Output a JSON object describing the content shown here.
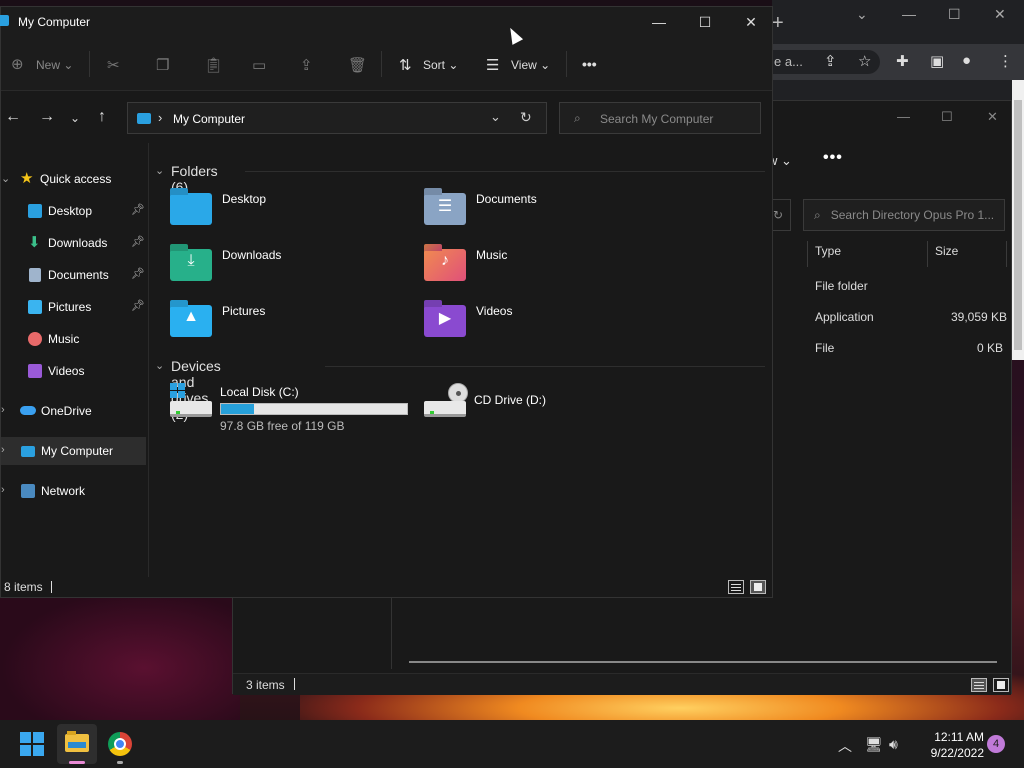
{
  "explorer": {
    "title": "My Computer",
    "commands": {
      "new": "New",
      "sort": "Sort",
      "view": "View",
      "more": "•••"
    },
    "address": "My Computer",
    "search_placeholder": "Search My Computer",
    "nav": {
      "quick_access": "Quick access",
      "pinned": [
        "Desktop",
        "Downloads",
        "Documents",
        "Pictures"
      ],
      "unpinned": [
        "Music",
        "Videos"
      ],
      "onedrive": "OneDrive",
      "my_computer": "My Computer",
      "network": "Network"
    },
    "folders_header": "Folders (6)",
    "folders": [
      "Desktop",
      "Documents",
      "Downloads",
      "Music",
      "Pictures",
      "Videos"
    ],
    "drives_header": "Devices and drives (2)",
    "drives": [
      {
        "name": "Local Disk (C:)",
        "free_text": "97.8 GB free of 119 GB",
        "used_fraction": 0.18
      },
      {
        "name": "CD Drive (D:)"
      }
    ],
    "status": "8 items"
  },
  "opus": {
    "toolbar_fragment": "w",
    "more": "•••",
    "search_placeholder": "Search Directory Opus Pro 1...",
    "columns": [
      "Type",
      "Size"
    ],
    "rows": [
      {
        "type": "File folder",
        "size": ""
      },
      {
        "type": "Application",
        "size": "39,059 KB"
      },
      {
        "type": "File",
        "size": "0 KB"
      }
    ],
    "status": "3 items"
  },
  "chrome": {
    "omnibox_fragment": "e a..."
  },
  "taskbar": {
    "time": "12:11 AM",
    "date": "9/22/2022",
    "notifications": "4"
  },
  "colors": {
    "accent": "#26a0da",
    "folder_blue": "#2aa0e0"
  }
}
